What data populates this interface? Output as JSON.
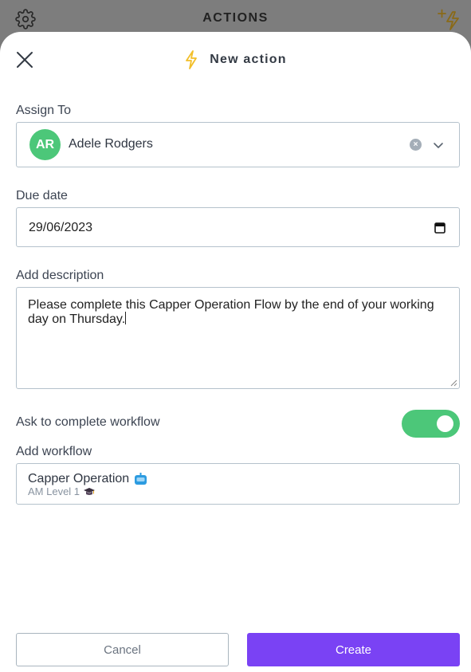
{
  "topbar": {
    "title": "ACTIONS",
    "settings_icon": "gear-icon",
    "add_action_icon": "add-lightning-icon"
  },
  "sheet": {
    "title": "New action",
    "title_icon": "lightning-icon",
    "close_icon": "close-icon"
  },
  "assign": {
    "label": "Assign To",
    "avatar_initials": "AR",
    "avatar_color": "#4cc779",
    "assignee_name": "Adele Rodgers"
  },
  "due_date": {
    "label": "Due date",
    "value": "29/06/2023"
  },
  "description": {
    "label": "Add description",
    "value": "Please complete this Capper Operation Flow by the end of your working day on Thursday."
  },
  "complete_workflow": {
    "label": "Ask to complete workflow",
    "enabled": true
  },
  "workflow": {
    "label": "Add workflow",
    "name": "Capper Operation",
    "level": "AM Level 1"
  },
  "actions": {
    "cancel_label": "Cancel",
    "create_label": "Create"
  },
  "colors": {
    "accent_purple": "#7a42f4",
    "success_green": "#4cc779",
    "lightning_yellow": "#f2bf2a"
  }
}
